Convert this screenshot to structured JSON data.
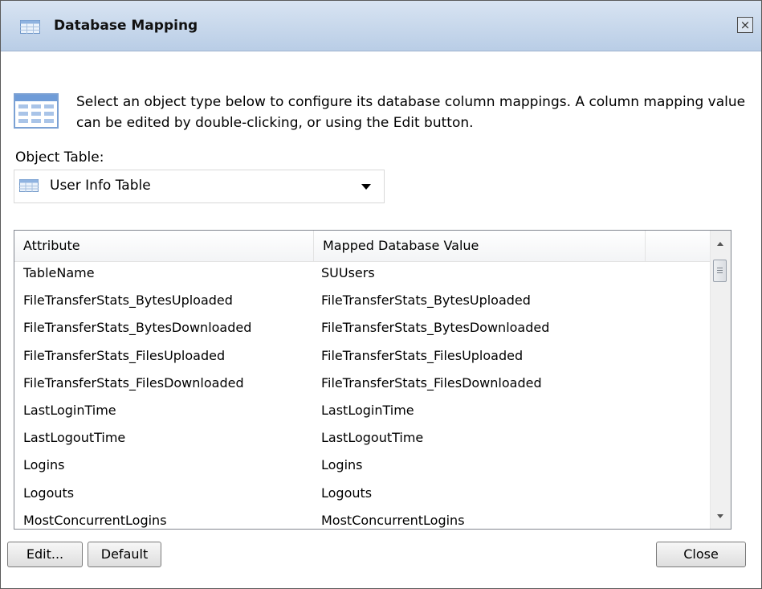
{
  "window": {
    "title": "Database Mapping",
    "close_glyph": "×"
  },
  "description": "Select an object type below to configure its database column mappings. A column mapping value can be edited by double-clicking, or using the Edit button.",
  "object_table": {
    "label": "Object Table:",
    "selected": "User Info Table"
  },
  "list": {
    "columns": [
      "Attribute",
      "Mapped Database Value"
    ],
    "rows": [
      {
        "attribute": "TableName",
        "mapped": "SUUsers"
      },
      {
        "attribute": "FileTransferStats_BytesUploaded",
        "mapped": "FileTransferStats_BytesUploaded"
      },
      {
        "attribute": "FileTransferStats_BytesDownloaded",
        "mapped": "FileTransferStats_BytesDownloaded"
      },
      {
        "attribute": "FileTransferStats_FilesUploaded",
        "mapped": "FileTransferStats_FilesUploaded"
      },
      {
        "attribute": "FileTransferStats_FilesDownloaded",
        "mapped": "FileTransferStats_FilesDownloaded"
      },
      {
        "attribute": "LastLoginTime",
        "mapped": "LastLoginTime"
      },
      {
        "attribute": "LastLogoutTime",
        "mapped": "LastLogoutTime"
      },
      {
        "attribute": "Logins",
        "mapped": "Logins"
      },
      {
        "attribute": "Logouts",
        "mapped": "Logouts"
      },
      {
        "attribute": "MostConcurrentLogins",
        "mapped": "MostConcurrentLogins"
      }
    ]
  },
  "buttons": {
    "edit": "Edit...",
    "default": "Default",
    "close": "Close"
  },
  "colors": {
    "titlebar_top": "#d8e4f2",
    "titlebar_bottom": "#b9cde6",
    "table_icon": "#5b8fd2"
  }
}
